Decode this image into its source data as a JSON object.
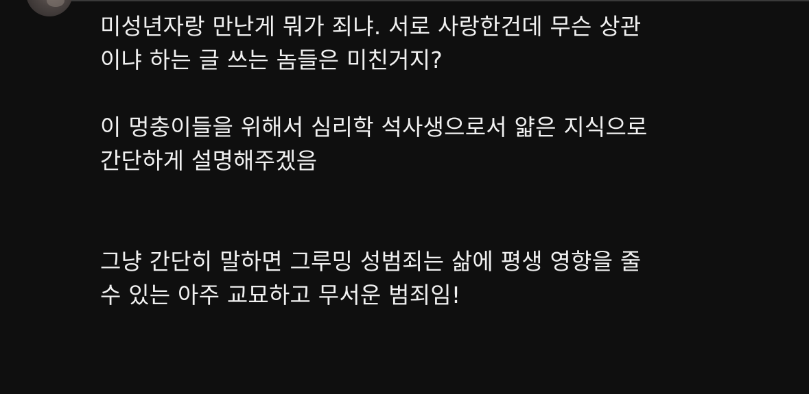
{
  "comment": {
    "avatar_icon": "user-avatar",
    "paragraphs": [
      {
        "lines": [
          "미성년자랑 만난게 뭐가 죄냐. 서로 사랑한건데 무슨 상관",
          "이냐 하는 글 쓰는 놈들은 미친거지?"
        ]
      },
      {
        "lines": [
          "이 멍충이들을 위해서 심리학 석사생으로서 얇은 지식으로",
          "간단하게 설명해주겠음"
        ]
      },
      {
        "lines": [
          "그냥 간단히 말하면 그루밍 성범죄는 삶에 평생 영향을 줄",
          "수 있는 아주 교묘하고 무서운 범죄임!"
        ]
      }
    ]
  },
  "colors": {
    "background": "#0f0f0f",
    "text": "#f1f1f1",
    "divider": "#3a3a3a"
  }
}
